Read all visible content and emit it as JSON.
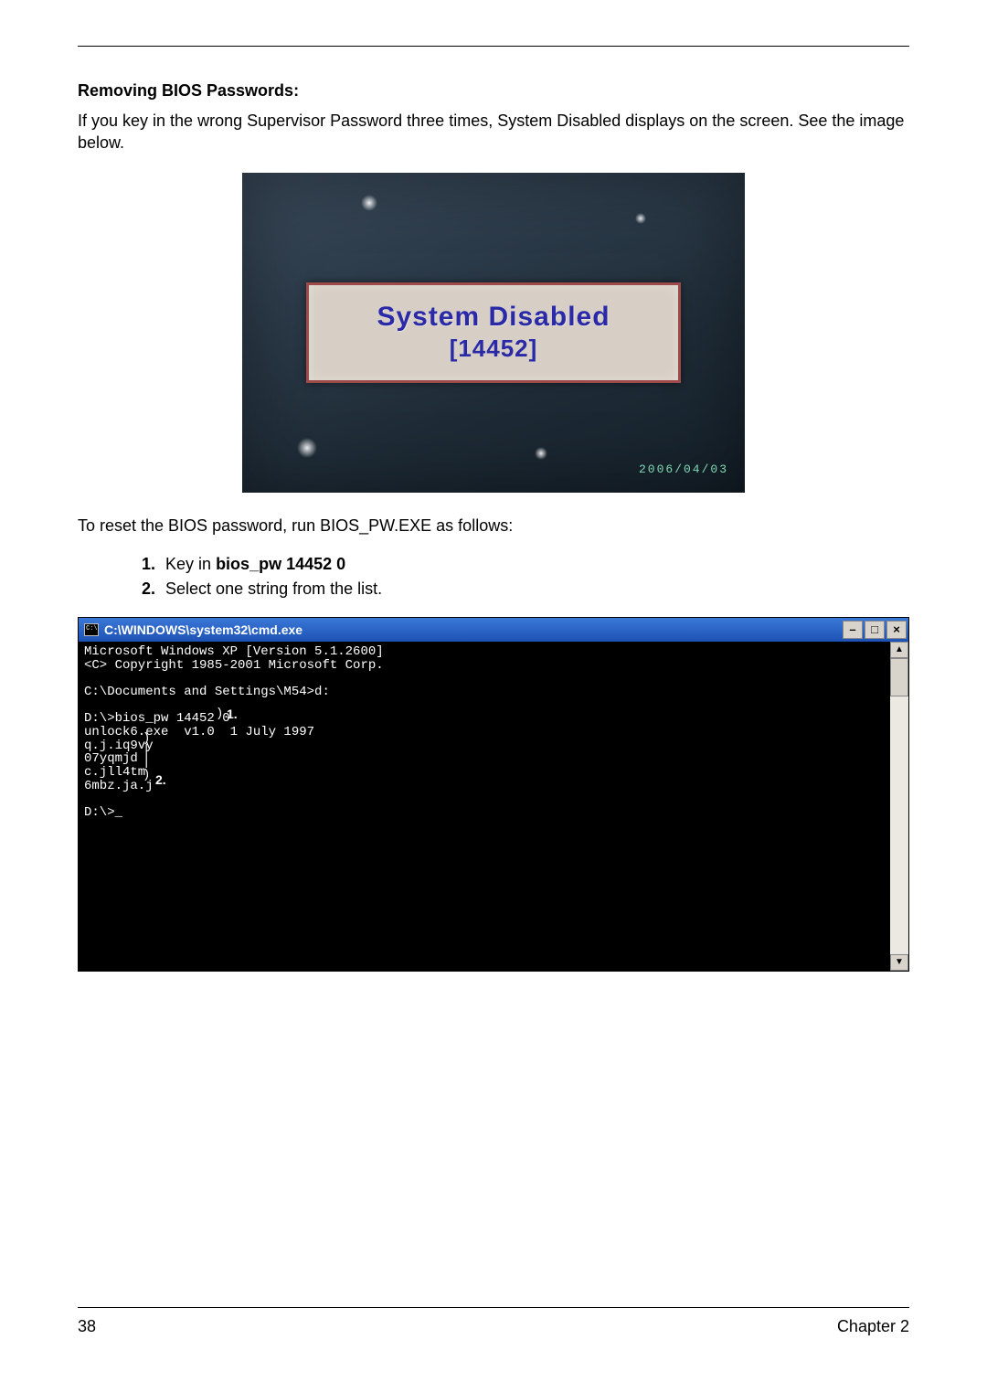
{
  "heading": "Removing BIOS Passwords:",
  "intro": "If you key in the wrong Supervisor Password three times, System Disabled displays on the screen. See the image below.",
  "bios_screen": {
    "title": "System Disabled",
    "code": "[14452]",
    "date": "2006/04/03"
  },
  "reset_instruction": "To reset the BIOS password, run BIOS_PW.EXE as follows:",
  "steps": [
    {
      "num": "1.",
      "prefix": "Key in ",
      "bold": "bios_pw 14452 0"
    },
    {
      "num": "2.",
      "prefix": "Select one string from the list.",
      "bold": ""
    }
  ],
  "cmd": {
    "title": "C:\\WINDOWS\\system32\\cmd.exe",
    "buttons": {
      "min": "–",
      "max": "□",
      "close": "×"
    },
    "lines": {
      "l1": "Microsoft Windows XP [Version 5.1.2600]",
      "l2": "<C> Copyright 1985-2001 Microsoft Corp.",
      "l3": "",
      "l4": "C:\\Documents and Settings\\M54>d:",
      "l5": "",
      "l6": "D:\\>bios_pw 14452 0",
      "l7": "unlock6.exe  v1.0  1 July 1997",
      "l8": "q.j.iq9vy",
      "l9": "07yqmjd",
      "l10": "c.jll4tm",
      "l11": "6mbz.ja.j",
      "l12": "",
      "l13": "D:\\>_"
    },
    "annotation1": "1.",
    "annotation2": "2."
  },
  "footer": {
    "page": "38",
    "chapter": "Chapter 2"
  }
}
